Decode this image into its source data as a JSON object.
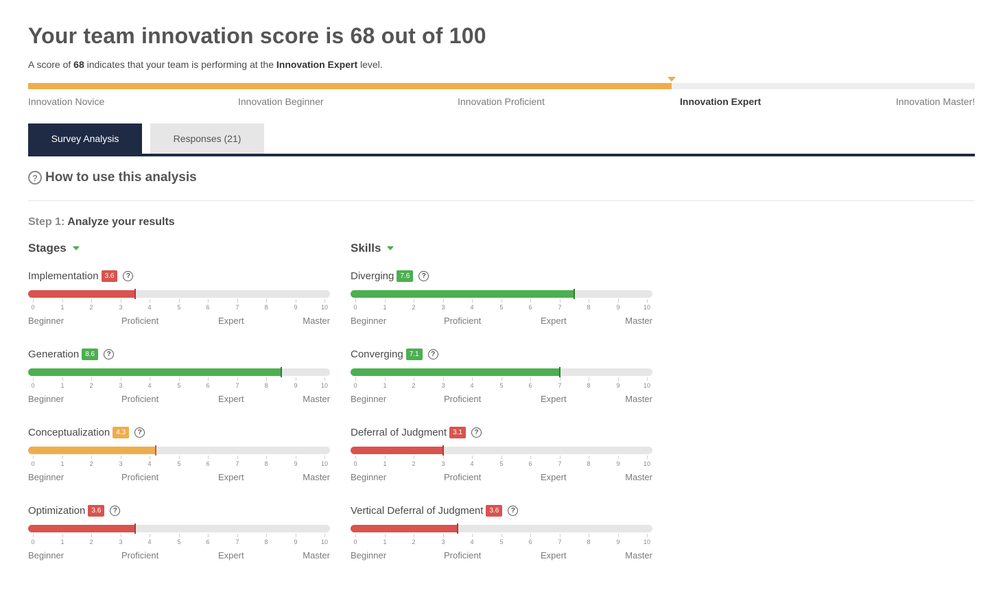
{
  "header": {
    "title": "Your team innovation score is 68 out of 100",
    "subtitle_pre": "A score of ",
    "subtitle_score": "68",
    "subtitle_mid": " indicates that your team is performing at the ",
    "subtitle_level": "Innovation Expert",
    "subtitle_post": " level."
  },
  "progress": {
    "score": 68,
    "max": 100,
    "levels": [
      "Innovation Novice",
      "Innovation Beginner",
      "Innovation Proficient",
      "Innovation Expert",
      "Innovation Master!"
    ],
    "active_level": 3
  },
  "tabs": [
    {
      "label": "Survey Analysis",
      "active": true
    },
    {
      "label": "Responses (21)",
      "active": false
    }
  ],
  "howto": {
    "icon": "?",
    "label": "How to use this analysis"
  },
  "step": {
    "label": "Step 1:",
    "text": "Analyze your results"
  },
  "scale": {
    "ticks": [
      "0",
      "1",
      "2",
      "3",
      "4",
      "5",
      "6",
      "7",
      "8",
      "9",
      "10"
    ],
    "tiers": [
      "Beginner",
      "Proficient",
      "Expert",
      "Master"
    ]
  },
  "colors": {
    "red": "#d9534f",
    "green": "#4caf50",
    "orange": "#efad4a",
    "navy": "#1f2a44"
  },
  "stages": {
    "title": "Stages",
    "items": [
      {
        "name": "Implementation",
        "score": "3.6",
        "value": 3.6,
        "color": "#d9534f"
      },
      {
        "name": "Generation",
        "score": "8.6",
        "value": 8.6,
        "color": "#4caf50"
      },
      {
        "name": "Conceptualization",
        "score": "4.3",
        "value": 4.3,
        "color": "#efad4a"
      },
      {
        "name": "Optimization",
        "score": "3.6",
        "value": 3.6,
        "color": "#d9534f"
      }
    ]
  },
  "skills": {
    "title": "Skills",
    "items": [
      {
        "name": "Diverging",
        "score": "7.6",
        "value": 7.6,
        "color": "#4caf50"
      },
      {
        "name": "Converging",
        "score": "7.1",
        "value": 7.1,
        "color": "#4caf50"
      },
      {
        "name": "Deferral of Judgment",
        "score": "3.1",
        "value": 3.1,
        "color": "#d9534f"
      },
      {
        "name": "Vertical Deferral of Judgment",
        "score": "3.6",
        "value": 3.6,
        "color": "#d9534f"
      }
    ]
  }
}
